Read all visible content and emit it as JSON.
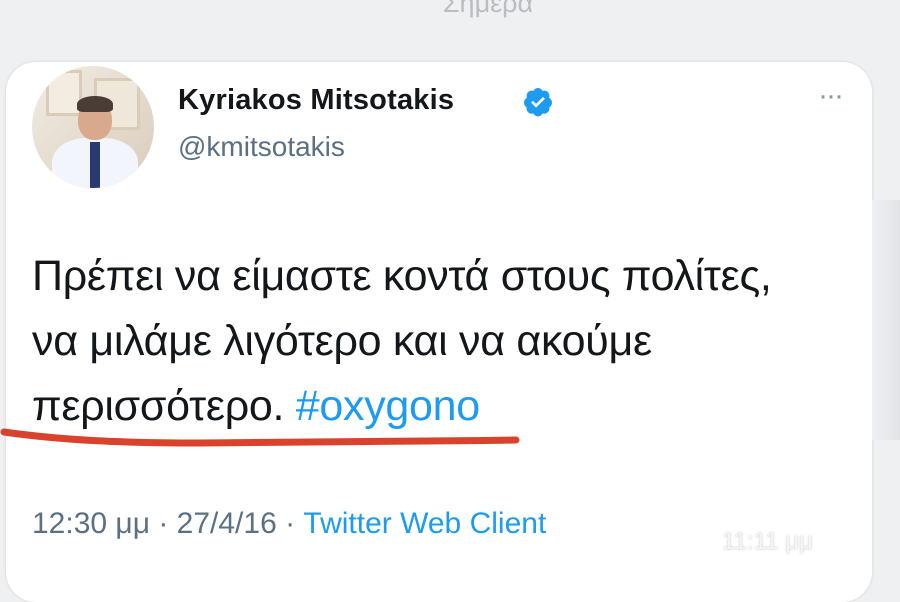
{
  "day_label": "Σημερα",
  "tweet": {
    "author_name": "Kyriakos Mitsotakis",
    "handle": "@kmitsotakis",
    "more_icon": "···",
    "text_before_hashtag": "Πρέπει να είμαστε κοντά στους πολίτες, να μιλάμε λιγότερο και να ακούμε περισσότερο. ",
    "hashtag": "#oxygono",
    "time": "12:30 μμ",
    "separator1": " · ",
    "date": "27/4/16",
    "separator2": " · ",
    "client": "Twitter Web Client"
  },
  "message_time": "11:11 μμ",
  "colors": {
    "link_blue": "#1d9bf0",
    "underline_red": "#d9432e",
    "secondary_text": "#5b7083"
  }
}
